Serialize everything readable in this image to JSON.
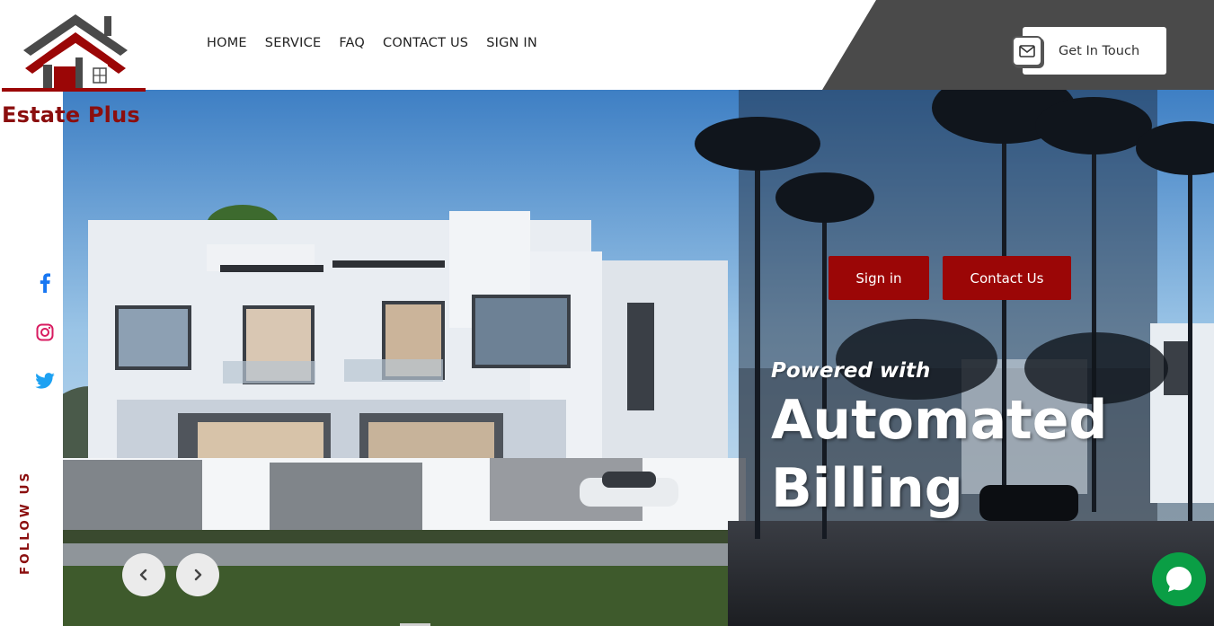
{
  "brand": {
    "name": "Estate Plus",
    "primary_color": "#8b0e0e",
    "dark_color": "#4a4a4a"
  },
  "nav": {
    "items": [
      {
        "label": "HOME"
      },
      {
        "label": "SERVICE"
      },
      {
        "label": "FAQ"
      },
      {
        "label": "CONTACT US"
      },
      {
        "label": "SIGN IN"
      }
    ]
  },
  "header": {
    "cta_label": "Get In Touch",
    "cta_icon": "envelope-icon"
  },
  "hero": {
    "signin_label": "Sign in",
    "contact_label": "Contact Us",
    "subtitle": "Powered with",
    "title_line1": "Automated",
    "title_line2": "Billing",
    "button_color": "#9b0606",
    "prev_icon": "chevron-left-icon",
    "next_icon": "chevron-right-icon"
  },
  "social": {
    "label": "FOLLOW US",
    "icons": [
      "facebook-icon",
      "instagram-icon",
      "twitter-icon"
    ]
  },
  "chat": {
    "icon": "chat-bubble-icon",
    "color": "#0a9e45"
  }
}
